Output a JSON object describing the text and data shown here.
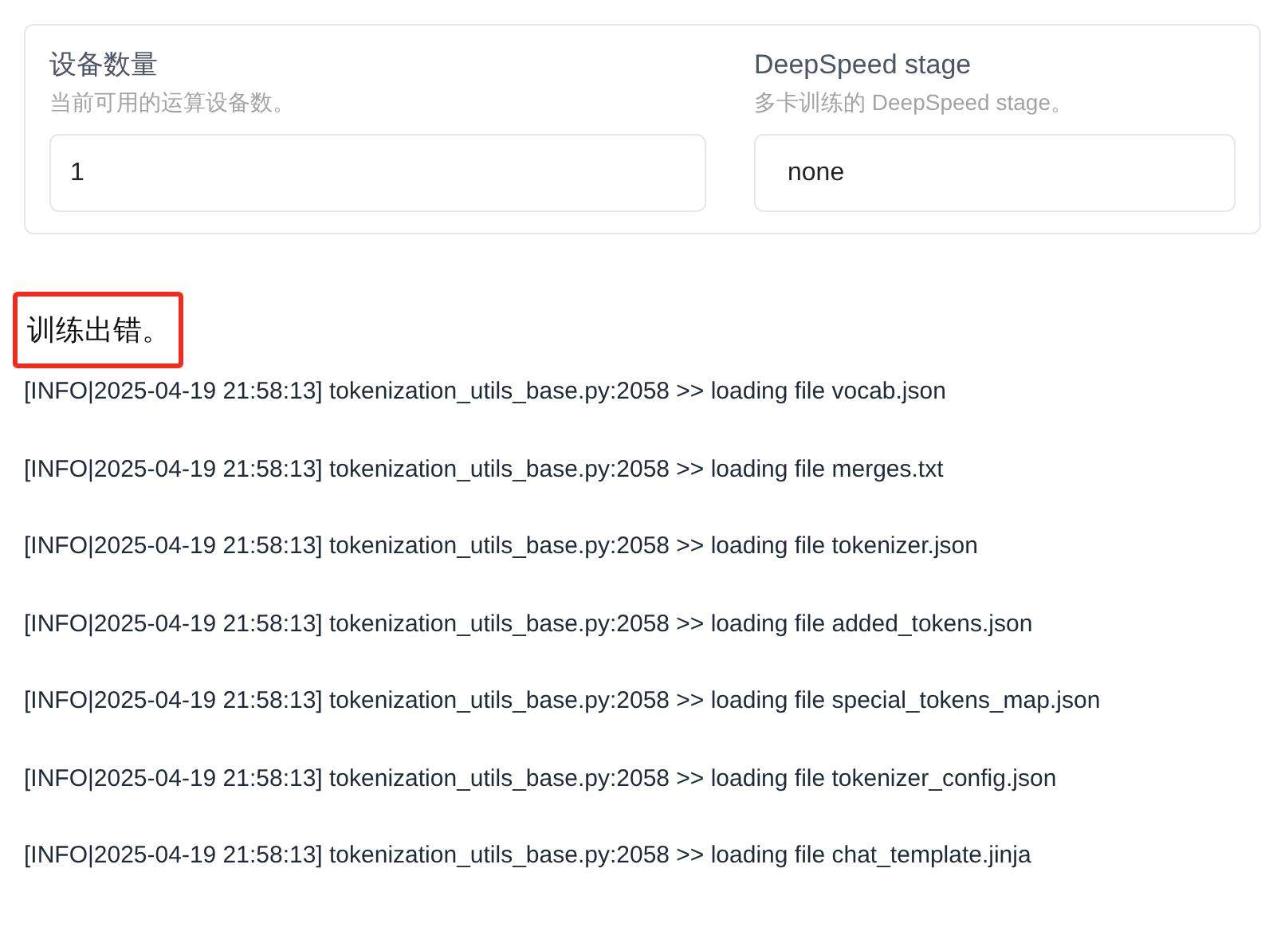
{
  "settings": [
    {
      "label": "设备数量",
      "info": "当前可用的运算设备数。",
      "value": "1",
      "kind": "number"
    },
    {
      "label": "DeepSpeed stage",
      "info": "多卡训练的 DeepSpeed stage。",
      "value": "none",
      "kind": "dropdown"
    }
  ],
  "status": {
    "text": "训练出错。",
    "highlighted": true
  },
  "log": [
    "[INFO|2025-04-19 21:58:13] tokenization_utils_base.py:2058 >> loading file vocab.json",
    "[INFO|2025-04-19 21:58:13] tokenization_utils_base.py:2058 >> loading file merges.txt",
    "[INFO|2025-04-19 21:58:13] tokenization_utils_base.py:2058 >> loading file tokenizer.json",
    "[INFO|2025-04-19 21:58:13] tokenization_utils_base.py:2058 >> loading file added_tokens.json",
    "[INFO|2025-04-19 21:58:13] tokenization_utils_base.py:2058 >> loading file special_tokens_map.json",
    "[INFO|2025-04-19 21:58:13] tokenization_utils_base.py:2058 >> loading file tokenizer_config.json",
    "[INFO|2025-04-19 21:58:13] tokenization_utils_base.py:2058 >> loading file chat_template.jinja"
  ]
}
